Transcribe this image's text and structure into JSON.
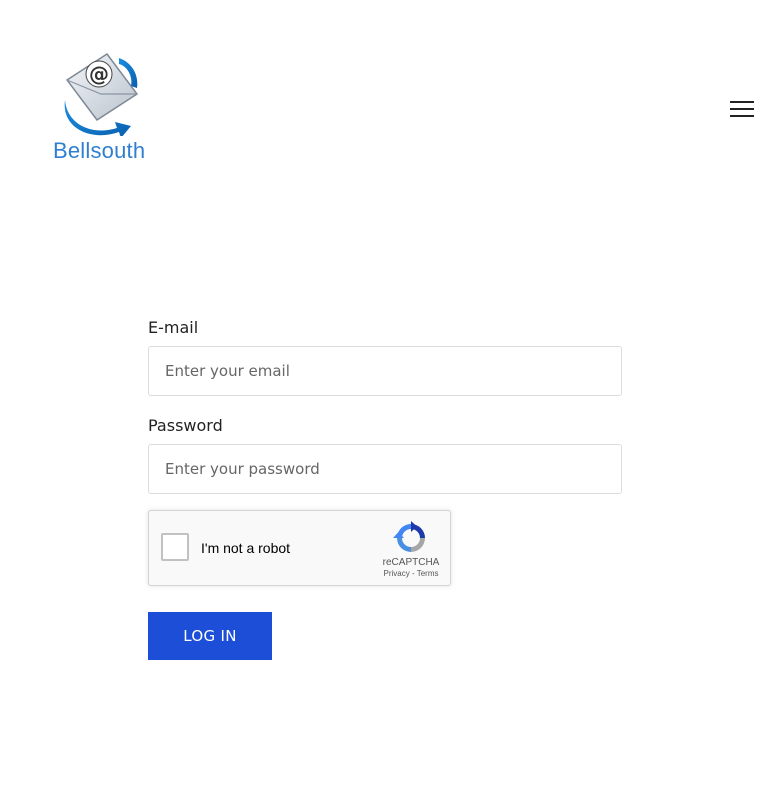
{
  "brand": {
    "name": "Bellsouth",
    "logo_icon": "email-at-envelope-icon",
    "color": "#2f7fd1"
  },
  "header": {
    "menu_icon": "hamburger-menu-icon"
  },
  "form": {
    "email": {
      "label": "E-mail",
      "placeholder": "Enter your email",
      "value": ""
    },
    "password": {
      "label": "Password",
      "placeholder": "Enter your password",
      "value": ""
    },
    "recaptcha": {
      "label": "I'm not a robot",
      "brand": "reCAPTCHA",
      "privacy_link": "Privacy",
      "separator": " - ",
      "terms_link": "Terms",
      "checked": false
    },
    "submit_label": "Log In",
    "submit_color": "#1d4ed8"
  }
}
